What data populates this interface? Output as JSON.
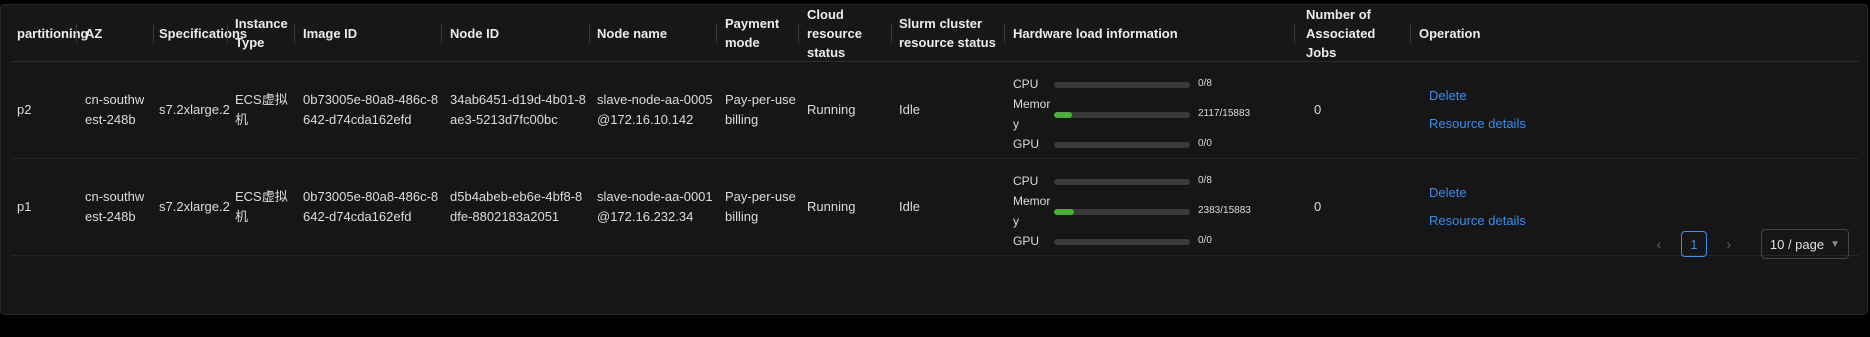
{
  "columns": [
    "partitioning",
    "AZ",
    "Specifications",
    "Instance Type",
    "Image ID",
    "Node ID",
    "Node name",
    "Payment mode",
    "Cloud resource status",
    "Slurm cluster resource status",
    "Hardware load information",
    "Number of Associated Jobs",
    "Operation"
  ],
  "rows": [
    {
      "partition": "p2",
      "az": "cn-southwest-248b",
      "spec": "s7.2xlarge.2",
      "instance_type": "ECS虚拟机",
      "image_id": "0b73005e-80a8-486c-8642-d74cda162efd",
      "node_id": "34ab6451-d19d-4b01-8ae3-5213d7fc00bc",
      "node_name": "slave-node-aa-0005@172.16.10.142",
      "payment": "Pay-per-use billing",
      "cloud_status": "Running",
      "slurm_status": "Idle",
      "hw": {
        "cpu_label": "CPU",
        "cpu_value": "0/8",
        "cpu_fraction": 0,
        "mem_label": "Memory",
        "mem_value": "2117/15883",
        "mem_fraction": 0.133,
        "gpu_label": "GPU",
        "gpu_value": "0/0",
        "gpu_fraction": 0
      },
      "jobs": "0",
      "op_delete": "Delete",
      "op_details": "Resource details"
    },
    {
      "partition": "p1",
      "az": "cn-southwest-248b",
      "spec": "s7.2xlarge.2",
      "instance_type": "ECS虚拟机",
      "image_id": "0b73005e-80a8-486c-8642-d74cda162efd",
      "node_id": "d5b4abeb-eb6e-4bf8-8dfe-8802183a2051",
      "node_name": "slave-node-aa-0001@172.16.232.34",
      "payment": "Pay-per-use billing",
      "cloud_status": "Running",
      "slurm_status": "Idle",
      "hw": {
        "cpu_label": "CPU",
        "cpu_value": "0/8",
        "cpu_fraction": 0,
        "mem_label": "Memory",
        "mem_value": "2383/15883",
        "mem_fraction": 0.15,
        "gpu_label": "GPU",
        "gpu_value": "0/0",
        "gpu_fraction": 0
      },
      "jobs": "0",
      "op_delete": "Delete",
      "op_details": "Resource details"
    }
  ],
  "pagination": {
    "prev_icon": "chevron-left-icon",
    "current_page": "1",
    "next_icon": "chevron-right-icon",
    "page_size": "10 / page"
  },
  "colors": {
    "link": "#3b8df0",
    "bar_fill": "#4caf3b",
    "bar_track": "#3a3a3a"
  }
}
